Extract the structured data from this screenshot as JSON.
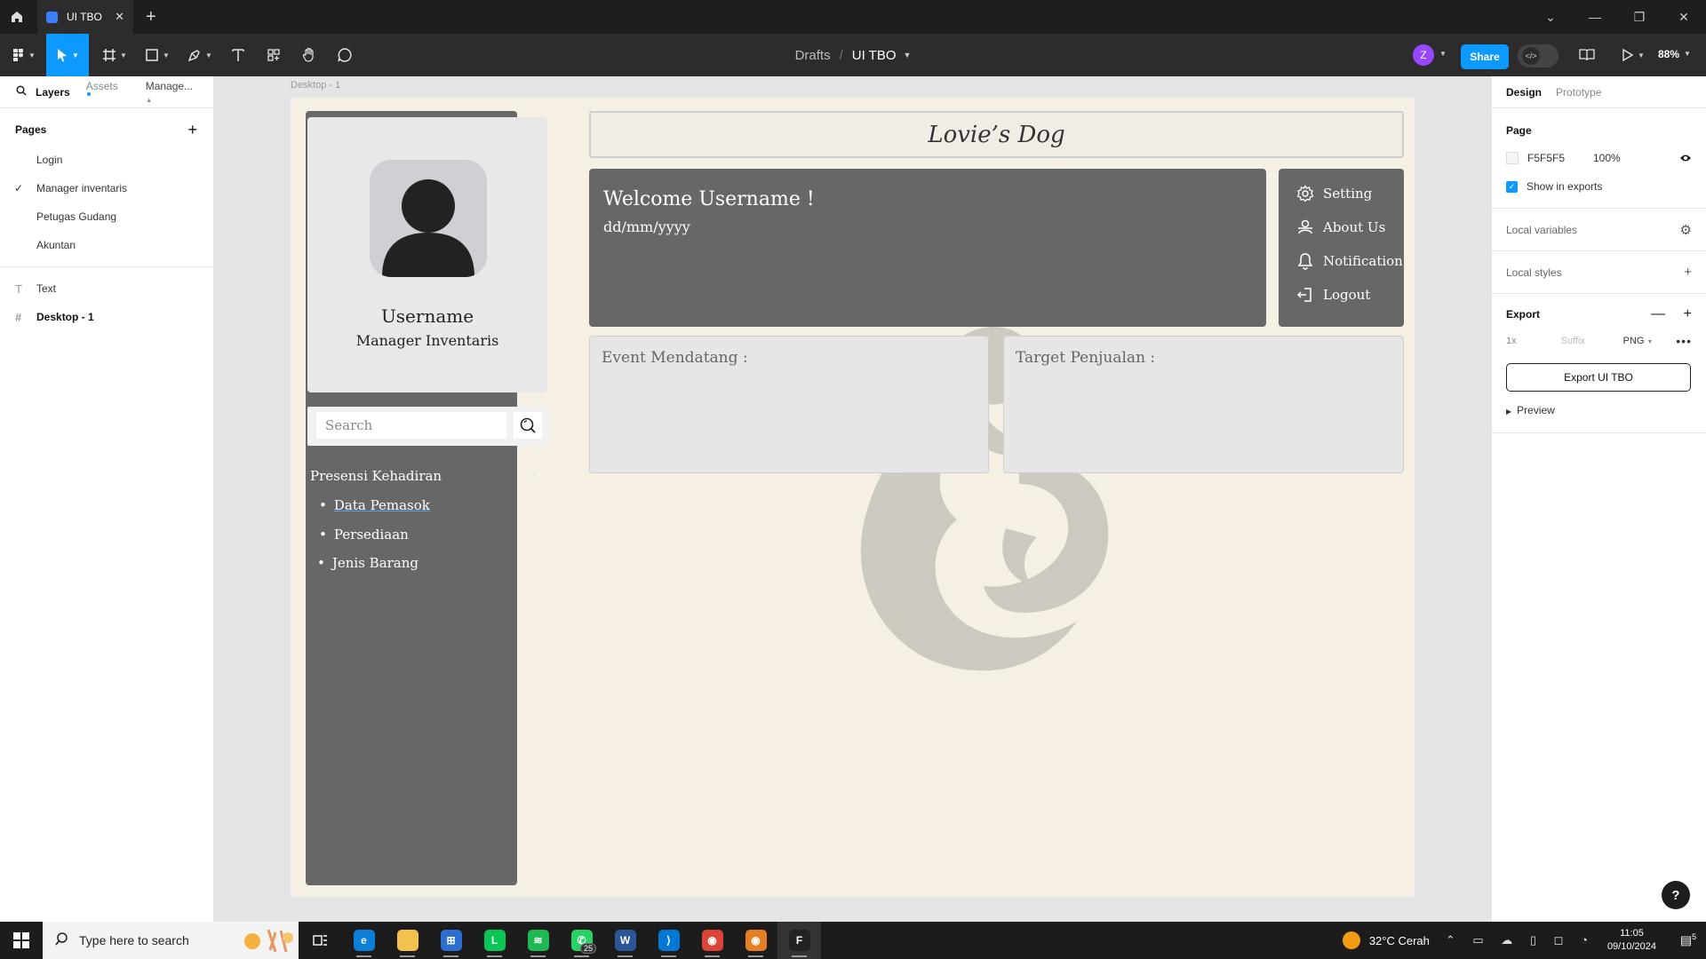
{
  "app": {
    "tab_title": "UI TBO",
    "breadcrumb": {
      "drafts": "Drafts",
      "separator": "/",
      "file": "UI TBO"
    },
    "user_initial": "Z",
    "share_label": "Share",
    "zoom": "88%"
  },
  "left_panel": {
    "tabs": {
      "layers": "Layers",
      "assets": "Assets",
      "manage": "Manage..."
    },
    "pages_title": "Pages",
    "pages": [
      {
        "label": "Login",
        "selected": false
      },
      {
        "label": "Manager inventaris",
        "selected": true
      },
      {
        "label": "Petugas Gudang",
        "selected": false
      },
      {
        "label": "Akuntan",
        "selected": false
      }
    ],
    "layers": [
      {
        "label": "Text",
        "icon": "T"
      },
      {
        "label": "Desktop - 1",
        "icon": "#"
      }
    ]
  },
  "right_panel": {
    "tabs": {
      "design": "Design",
      "prototype": "Prototype"
    },
    "page_title": "Page",
    "page_color": "F5F5F5",
    "page_opacity": "100%",
    "show_in_exports": "Show in exports",
    "local_variables": "Local variables",
    "local_styles": "Local styles",
    "export_title": "Export",
    "export_scale": "1x",
    "export_suffix_placeholder": "Suffix",
    "export_format": "PNG",
    "export_button": "Export UI TBO",
    "preview": "Preview"
  },
  "canvas": {
    "frame_label": "Desktop - 1",
    "sidebar": {
      "username": "Username",
      "role": "Manager Inventaris",
      "search_placeholder": "Search",
      "menu_header": "Presensi Kehadiran",
      "menu_items": [
        "Data Pemasok",
        "Persediaan",
        "Jenis Barang"
      ]
    },
    "brand": "Lovie’s Dog",
    "welcome_title": "Welcome Username !",
    "welcome_date": "dd/mm/yyyy",
    "quick_menu": [
      "Setting",
      "About Us",
      "Notification",
      "Logout"
    ],
    "event_card_title": "Event Mendatang :",
    "target_card_title": "Target Penjualan :"
  },
  "taskbar": {
    "search_placeholder": "Type here to search",
    "whatsapp_badge": "25",
    "temperature": "32°C",
    "weather": "Cerah",
    "time": "11:05",
    "date": "09/10/2024",
    "notification_count": "5",
    "apps": [
      "edge",
      "file-explorer",
      "store",
      "line",
      "spotify",
      "whatsapp",
      "word",
      "vscode",
      "chrome",
      "chrome-2",
      "figma"
    ]
  },
  "colors": {
    "accent": "#0d99ff",
    "frame_bg": "#f6f0e4",
    "dark_gray": "#676767",
    "card_gray": "#e6e6e6"
  }
}
